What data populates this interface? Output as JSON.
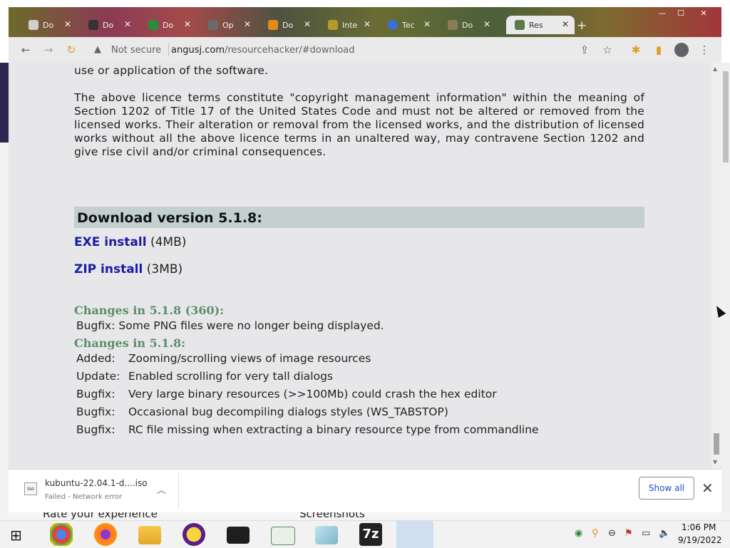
{
  "browser": {
    "tabs": [
      {
        "label": "Do",
        "favicon": "globe-icon"
      },
      {
        "label": "Do",
        "favicon": "trash-icon"
      },
      {
        "label": "Do",
        "favicon": "play-icon"
      },
      {
        "label": "Op",
        "favicon": "page-icon"
      },
      {
        "label": "Do",
        "favicon": "vlc-icon"
      },
      {
        "label": "Inte",
        "favicon": "page-icon"
      },
      {
        "label": "Tec",
        "favicon": "circle-icon"
      },
      {
        "label": "Do",
        "favicon": "page-icon"
      },
      {
        "label": "Res",
        "favicon": "aj-icon",
        "active": true
      }
    ],
    "new_tab_glyph": "+",
    "security_label": "Not secure",
    "url_domain": "angusj.com",
    "url_path": "/resourcehacker/#download"
  },
  "page": {
    "intro_tail": "use or application of the software.",
    "licence_para": "The above licence terms constitute \"copyright management information\" within the meaning of Section 1202 of Title 17 of the United States Code and must not be altered or removed from the licensed works. Their alteration or removal from the licensed works, and the distribution of licensed works without all the above licence terms in an unaltered way, may contravene Section 1202 and give rise civil and/or criminal consequences.",
    "download_heading": "Download version 5.1.8:",
    "downloads": [
      {
        "label": "EXE install",
        "size": "(4MB)"
      },
      {
        "label": "ZIP install",
        "size": "(3MB)"
      }
    ],
    "changes": [
      {
        "heading": "Changes in 5.1.8 (360):",
        "items": [
          {
            "kind": "Bugfix:",
            "text": "Some PNG files were no longer being displayed."
          }
        ]
      },
      {
        "heading": "Changes in 5.1.8:",
        "items": [
          {
            "kind": "Added:",
            "text": "Zooming/scrolling views of image resources"
          },
          {
            "kind": "Update:",
            "text": "Enabled scrolling for very tall dialogs"
          },
          {
            "kind": "Bugfix:",
            "text": "Very large binary resources (>>100Mb) could crash the hex editor"
          },
          {
            "kind": "Bugfix:",
            "text": "Occasional bug decompiling dialogs styles (WS_TABSTOP)"
          },
          {
            "kind": "Bugfix:",
            "text": "RC file missing when extracting a binary resource type from commandline"
          }
        ]
      }
    ]
  },
  "download_shelf": {
    "file_name": "kubuntu-22.04.1-d....iso",
    "status": "Failed - Network error",
    "file_icon_text": "iso",
    "show_all_label": "Show all"
  },
  "background": {
    "left_text": "Rate your experience",
    "right_text": "Screenshots"
  },
  "taskbar": {
    "time": "1:06 PM",
    "date": "9/19/2022",
    "apps": [
      "chrome-icon",
      "firefox-icon",
      "file-explorer-icon",
      "yahoo-messenger-icon",
      "terminal-icon",
      "notepad-icon",
      "notebook-icon",
      "7zip-icon",
      "network-icon"
    ],
    "seven_zip_label": "7z"
  },
  "colors": {
    "page_bg": "#e7e7e9",
    "section_bar": "#c4d0d0",
    "link": "#1a1aa6",
    "changes_heading": "#5c8c6c",
    "show_all_text": "#1a4fc4"
  }
}
